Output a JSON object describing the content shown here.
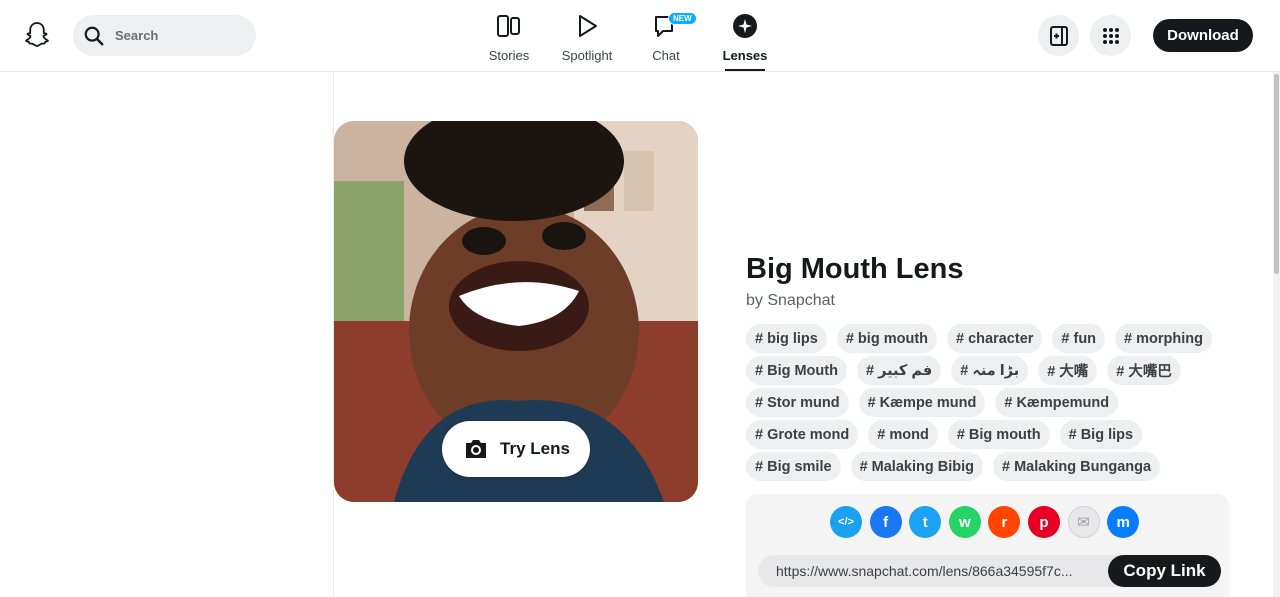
{
  "header": {
    "search_placeholder": "Search",
    "nav": [
      {
        "label": "Stories",
        "icon": "stories-icon"
      },
      {
        "label": "Spotlight",
        "icon": "spotlight-icon"
      },
      {
        "label": "Chat",
        "icon": "chat-icon",
        "badge": "NEW"
      },
      {
        "label": "Lenses",
        "icon": "lenses-icon",
        "active": true
      }
    ],
    "download_label": "Download"
  },
  "lens": {
    "try_label": "Try Lens",
    "title": "Big Mouth Lens",
    "author": "by Snapchat",
    "tag_rows": [
      [
        "# big lips",
        "# big mouth",
        "# character",
        "# fun",
        "# morphing"
      ],
      [
        "# Big Mouth",
        "# فم كبير",
        "# بڑا منہ",
        "# 大嘴",
        "# 大嘴巴"
      ],
      [
        "# Stor mund",
        "# Kæmpe mund",
        "# Kæmpemund"
      ],
      [
        "# Grote mond",
        "# mond",
        "# Big mouth",
        "# Big lips"
      ],
      [
        "# Big smile",
        "# Malaking Bibig",
        "# Malaking Bunganga"
      ]
    ]
  },
  "share": {
    "icons": [
      {
        "name": "embed-icon",
        "color": "#1ba1f1",
        "glyph": "</>"
      },
      {
        "name": "facebook-icon",
        "color": "#1877f2",
        "glyph": "f"
      },
      {
        "name": "twitter-icon",
        "color": "#1da1f2",
        "glyph": "t"
      },
      {
        "name": "whatsapp-icon",
        "color": "#25d366",
        "glyph": "w"
      },
      {
        "name": "reddit-icon",
        "color": "#ff4500",
        "glyph": "r"
      },
      {
        "name": "pinterest-icon",
        "color": "#e60023",
        "glyph": "p"
      },
      {
        "name": "email-icon",
        "color": "#e8e8ea",
        "glyph": "✉"
      },
      {
        "name": "messenger-icon",
        "color": "#0a7cff",
        "glyph": "m"
      }
    ],
    "link": "https://www.snapchat.com/lens/866a34595f7c...",
    "copy_label": "Copy Link"
  }
}
